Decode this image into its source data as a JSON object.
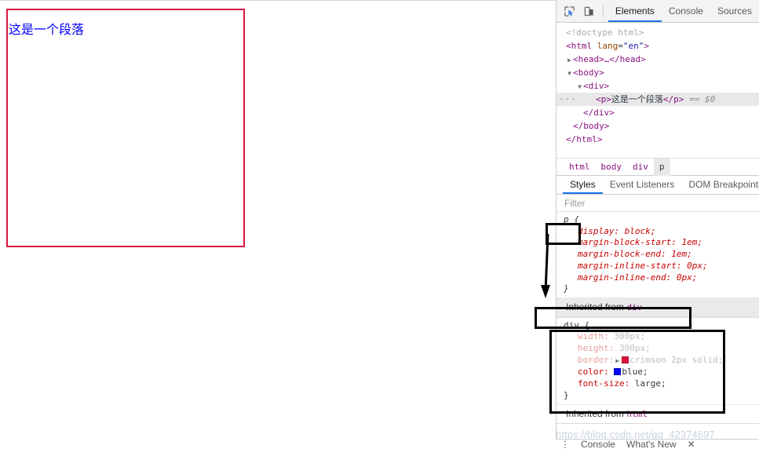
{
  "page": {
    "div_text": "这是一个段落",
    "border_color": "#dc143c",
    "text_color": "#0000ff"
  },
  "devtools": {
    "toolbar": {
      "inspect_icon": "inspect-element-icon",
      "device_icon": "device-toolbar-icon",
      "tabs": [
        {
          "label": "Elements",
          "active": true
        },
        {
          "label": "Console",
          "active": false
        },
        {
          "label": "Sources",
          "active": false
        }
      ]
    },
    "dom_tree": [
      {
        "indent": 0,
        "twisty": "",
        "text": "<!doctype html>",
        "kind": "doctype"
      },
      {
        "indent": 0,
        "twisty": "",
        "text": "<html lang=\"en\">",
        "kind": "html-open"
      },
      {
        "indent": 0,
        "twisty": "▶",
        "text": "<head>…</head>",
        "kind": "head"
      },
      {
        "indent": 0,
        "twisty": "▼",
        "text": "<body>",
        "kind": "body-open"
      },
      {
        "indent": 1,
        "twisty": "▼",
        "text": "<div>",
        "kind": "div-open"
      },
      {
        "indent": 2,
        "twisty": "",
        "text": "<p>这是一个段落</p> == $0",
        "kind": "p-selected",
        "selected": true,
        "dots": "···"
      },
      {
        "indent": 1,
        "twisty": "",
        "text": "</div>",
        "kind": "div-close"
      },
      {
        "indent": 0,
        "twisty": "",
        "text": "</body>",
        "kind": "body-close"
      },
      {
        "indent": 0,
        "twisty": "",
        "text": "</html>",
        "kind": "html-close"
      }
    ],
    "dom_tokens": {
      "doctype": "<!doctype html>",
      "html_open_tag": "html",
      "html_lang_attr": "lang",
      "html_lang_value": "\"en\"",
      "head_text": "<head>…</head>",
      "body_open": "<body>",
      "div_open": "<div>",
      "p_open": "<p>",
      "p_text": "这是一个段落",
      "p_close": "</p>",
      "selected_marker": "== $0",
      "div_close": "</div>",
      "body_close": "</body>",
      "html_close": "</html>"
    },
    "breadcrumb": [
      {
        "label": "html",
        "active": false
      },
      {
        "label": "body",
        "active": false
      },
      {
        "label": "div",
        "active": false
      },
      {
        "label": "p",
        "active": true
      }
    ],
    "style_tabs": [
      {
        "label": "Styles",
        "active": true
      },
      {
        "label": "Event Listeners",
        "active": false
      },
      {
        "label": "DOM Breakpoints",
        "active": false
      }
    ],
    "filter_placeholder": "Filter",
    "rules": [
      {
        "selector": "p {",
        "closing": "}",
        "user_agent": true,
        "declarations": [
          {
            "prop": "display",
            "value": "block;",
            "dim": false
          },
          {
            "prop": "margin-block-start",
            "value": "1em;",
            "dim": false
          },
          {
            "prop": "margin-block-end",
            "value": "1em;",
            "dim": false
          },
          {
            "prop": "margin-inline-start",
            "value": "0px;",
            "dim": false
          },
          {
            "prop": "margin-inline-end",
            "value": "0px;",
            "dim": false
          }
        ]
      }
    ],
    "inherited_div_label": "Inherited from",
    "inherited_div_tag": "div",
    "div_rule": {
      "selector": "div {",
      "closing": "}",
      "declarations": [
        {
          "prop": "width",
          "value": "300px;",
          "dim": true,
          "swatch": null
        },
        {
          "prop": "height",
          "value": "300px;",
          "dim": true,
          "swatch": null
        },
        {
          "prop": "border",
          "value": "crimson 2px solid;",
          "dim": true,
          "swatch": "#dc143c",
          "expander": "▶"
        },
        {
          "prop": "color",
          "value": "blue;",
          "dim": false,
          "swatch": "#0000ff"
        },
        {
          "prop": "font-size",
          "value": "large;",
          "dim": false,
          "swatch": null
        }
      ]
    },
    "inherited_html_label": "Inherited from",
    "inherited_html_tag": "html",
    "drawer": [
      {
        "label": "⋮"
      },
      {
        "label": "Console"
      },
      {
        "label": "What's New"
      },
      {
        "label": "✕"
      }
    ]
  },
  "watermark": "https://blog.csdn.net/qq_42374697"
}
